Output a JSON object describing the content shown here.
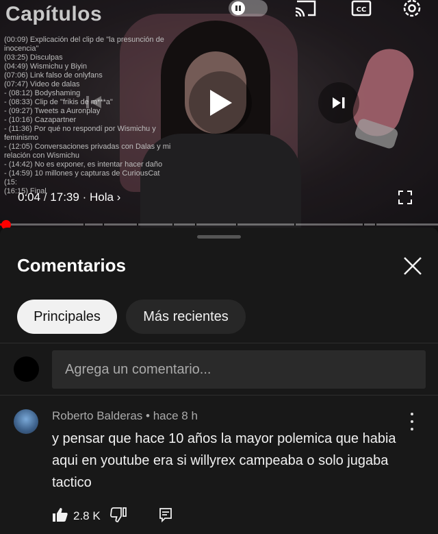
{
  "player": {
    "chapters_title": "Capítulos",
    "chapters": [
      "(00:09) Explicación del clip de \"la presunción de inocencia\"",
      "(03:25) Disculpas",
      "(04:49) Wismichu y Biyin",
      "(07:06) Link falso de onlyfans",
      "(07:47) Video de dalas",
      " - (08:12) Bodyshaming",
      " - (08:33) Clip de \"frikis de m***a\"",
      " - (09:27) Tweets a Auronplay",
      " - (10:16) Cazapartner",
      " - (11:36) Por qué no respondí por Wismichu y feminismo",
      " - (12:05) Conversaciones privadas con Dalas y mi relación con Wismichu",
      " - (14:42) No es exponer, es intentar hacer daño",
      " - (14:59) 10 millones y capturas de CuriousCat",
      "(15:",
      "(16:15) Final"
    ],
    "current_time": "0:04",
    "separator": "/",
    "duration": "17:39",
    "chapter_link": "· Hola ›",
    "progress_fraction": 0.005,
    "accent_color": "#ff0000",
    "icons": [
      "pause-toggle-icon",
      "cast-icon",
      "captions-icon",
      "settings-icon",
      "play-icon",
      "previous-icon",
      "next-icon",
      "fullscreen-icon"
    ]
  },
  "comments_panel": {
    "title": "Comentarios",
    "filters": [
      {
        "label": "Principales",
        "active": true
      },
      {
        "label": "Más recientes",
        "active": false
      }
    ],
    "input_placeholder": "Agrega un comentario...",
    "comment": {
      "author": "Roberto Balderas",
      "time": "• hace 8 h",
      "text": "y pensar que hace 10 años la mayor polemica que habia aqui en youtube era si willyrex campeaba o solo jugaba tactico",
      "likes": "2.8 K"
    }
  }
}
